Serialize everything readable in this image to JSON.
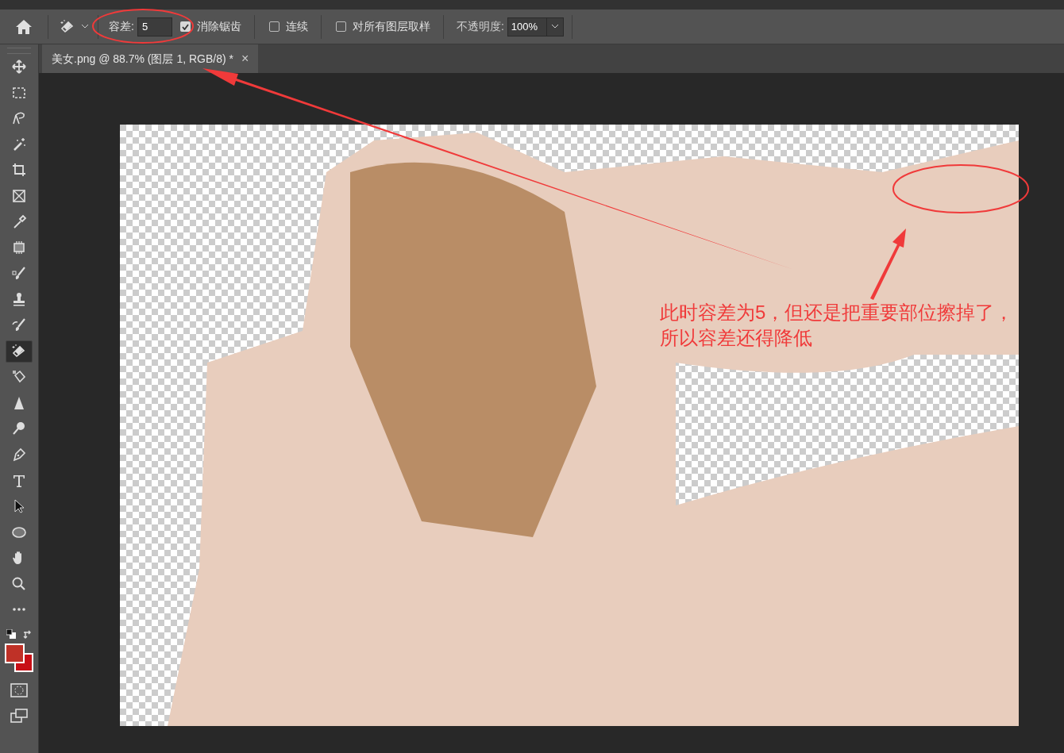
{
  "options_bar": {
    "tolerance": {
      "label": "容差:",
      "value": "5"
    },
    "checkboxes": [
      {
        "label": "消除锯齿",
        "checked": true
      },
      {
        "label": "连续",
        "checked": false
      },
      {
        "label": "对所有图层取样",
        "checked": false
      }
    ],
    "opacity": {
      "label": "不透明度:",
      "value": "100%"
    }
  },
  "document_tab": {
    "title": "美女.png @ 88.7% (图层 1, RGB/8) *",
    "close": "×"
  },
  "tools": [
    {
      "kind": "move",
      "selected": false
    },
    {
      "kind": "marquee",
      "selected": false
    },
    {
      "kind": "lasso",
      "selected": false
    },
    {
      "kind": "wand",
      "selected": false
    },
    {
      "kind": "crop",
      "selected": false
    },
    {
      "kind": "frame",
      "selected": false
    },
    {
      "kind": "eyedropper",
      "selected": false
    },
    {
      "kind": "patch",
      "selected": false
    },
    {
      "kind": "brush",
      "selected": false
    },
    {
      "kind": "stamp",
      "selected": false
    },
    {
      "kind": "history",
      "selected": false
    },
    {
      "kind": "eraser",
      "selected": true
    },
    {
      "kind": "bucket",
      "selected": false
    },
    {
      "kind": "blur",
      "selected": false
    },
    {
      "kind": "dodge",
      "selected": false
    },
    {
      "kind": "pen",
      "selected": false
    },
    {
      "kind": "type",
      "selected": false
    },
    {
      "kind": "select",
      "selected": false
    },
    {
      "kind": "ellipse",
      "selected": false
    },
    {
      "kind": "hand",
      "selected": false
    },
    {
      "kind": "zoom",
      "selected": false
    },
    {
      "kind": "more",
      "selected": false
    }
  ],
  "annotation": {
    "text": "此时容差为5，但还是把重要部位擦掉了，所以容差还得降低"
  }
}
